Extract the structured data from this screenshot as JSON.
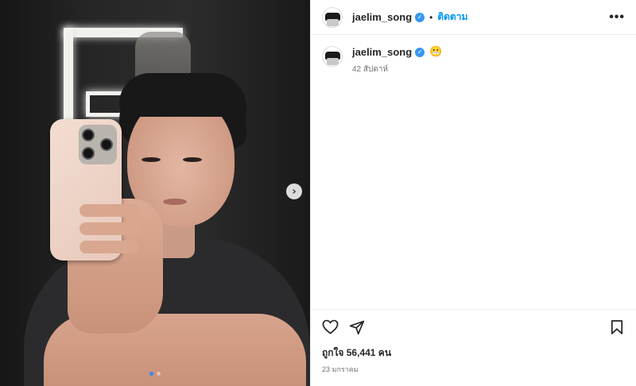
{
  "post": {
    "username": "jaelim_song",
    "verified_icon": "verified-badge-icon",
    "separator": "•",
    "follow_label": "ติดตาม",
    "more_label": "•••",
    "caption_emoji": "😬",
    "time_ago": "42 สัปดาห์",
    "likes_text": "ถูกใจ 56,441 คน",
    "date_text": "23 มกราคม"
  },
  "media": {
    "next_arrow": "›",
    "dots": 2,
    "active_dot_index": 0,
    "accent_color": "#2f8af5"
  },
  "icons": {
    "like": "heart-outline-icon",
    "share": "paper-plane-icon",
    "save": "bookmark-icon"
  },
  "colors": {
    "link": "#0095f6",
    "verified": "#3897f0",
    "muted": "#737373"
  }
}
